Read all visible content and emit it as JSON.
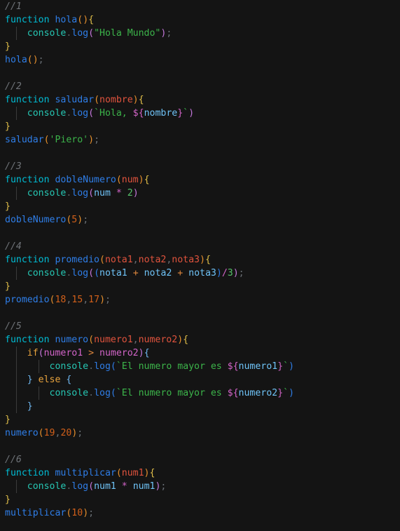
{
  "editor": {
    "background": "#141414",
    "language": "javascript",
    "font_size_px": 13,
    "line_height_px": 19,
    "indent_guide_color": "#3b3b3b",
    "total_lines": 40
  },
  "palette": {
    "comment": "#6f7378",
    "keyword_function": "#00bcd4",
    "keyword_control": "#e8a33d",
    "function_name": "#2f7ee8",
    "object_console": "#26c6b3",
    "method": "#2f7ee8",
    "string": "#3cb44a",
    "number_literal": "#d2601a",
    "number_expression": "#56c06a",
    "bracket_orange": "#e8912d",
    "bracket_purple": "#c678dd",
    "bracket_blue": "#2f7ee8",
    "brace_yellow": "#e2c04a",
    "brace_lightblue": "#6fb7f0",
    "parameter": "#e0533d",
    "variable": "#6fc3f7",
    "variable_magenta": "#d264c8",
    "operator": "#e0883d",
    "punctuation": "#6a7076",
    "template_expr": "#d264c8"
  },
  "code": {
    "sections": [
      {
        "comment": "//1",
        "lines": [
          "function hola(){",
          "    console.log(\"Hola Mundo\");",
          "}",
          "hola();"
        ]
      },
      {
        "comment": "//2",
        "lines": [
          "function saludar(nombre){",
          "    console.log(`Hola, ${nombre}`)",
          "}",
          "saludar('Piero');"
        ]
      },
      {
        "comment": "//3",
        "lines": [
          "function dobleNumero(num){",
          "    console.log(num * 2)",
          "}",
          "dobleNumero(5);"
        ]
      },
      {
        "comment": "//4",
        "lines": [
          "function promedio(nota1,nota2,nota3){",
          "    console.log((nota1 + nota2 + nota3)/3);",
          "}",
          "promedio(18,15,17);"
        ]
      },
      {
        "comment": "//5",
        "lines": [
          "function numero(numero1,numero2){",
          "    if(numero1 > numero2){",
          "        console.log(`El numero mayor es ${numero1}`)",
          "    } else {",
          "        console.log(`El numero mayor es ${numero2}`)",
          "    }",
          "}",
          "numero(19,20);"
        ]
      },
      {
        "comment": "//6",
        "lines": [
          "function multiplicar(num1){",
          "    console.log(num1 * num1);",
          "}",
          "multiplicar(10);"
        ]
      }
    ],
    "tokens": {
      "kw_function": "function",
      "kw_if": "if",
      "kw_else": "else",
      "obj_console": "console",
      "mth_log": "log",
      "fn_hola": "hola",
      "fn_saludar": "saludar",
      "fn_dobleNumero": "dobleNumero",
      "fn_promedio": "promedio",
      "fn_numero": "numero",
      "fn_multiplicar": "multiplicar",
      "prm_nombre": "nombre",
      "prm_num": "num",
      "prm_nota1": "nota1",
      "prm_nota2": "nota2",
      "prm_nota3": "nota3",
      "prm_numero1": "numero1",
      "prm_numero2": "numero2",
      "prm_num1": "num1",
      "str_hola_mundo": "\"Hola Mundo\"",
      "str_piero": "'Piero'",
      "str_tpl_hola": "Hola, ",
      "str_tpl_mayor": "El numero mayor es ",
      "num_2": "2",
      "num_3": "3",
      "num_5": "5",
      "num_10": "10",
      "num_15": "15",
      "num_17": "17",
      "num_18": "18",
      "num_19": "19",
      "num_20": "20",
      "comment_1": "//1",
      "comment_2": "//2",
      "comment_3": "//3",
      "comment_4": "//4",
      "comment_5": "//5",
      "comment_6": "//6"
    }
  }
}
